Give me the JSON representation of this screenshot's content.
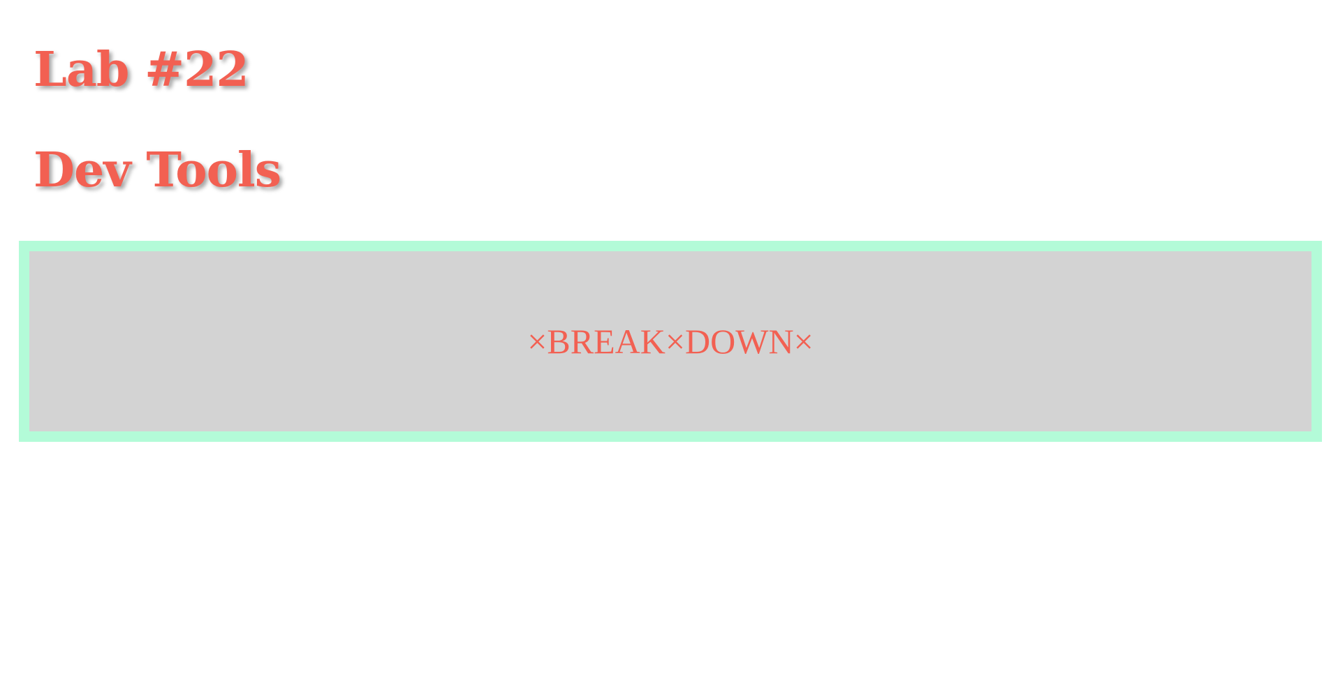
{
  "headings": {
    "lab": "Lab #22",
    "dev": "Dev Tools"
  },
  "banner": {
    "text": "×BREAK×DOWN×"
  },
  "colors": {
    "accent": "#f26052",
    "border": "#b3fbd8",
    "panel": "#d3d3d3",
    "background": "#ffffff"
  }
}
